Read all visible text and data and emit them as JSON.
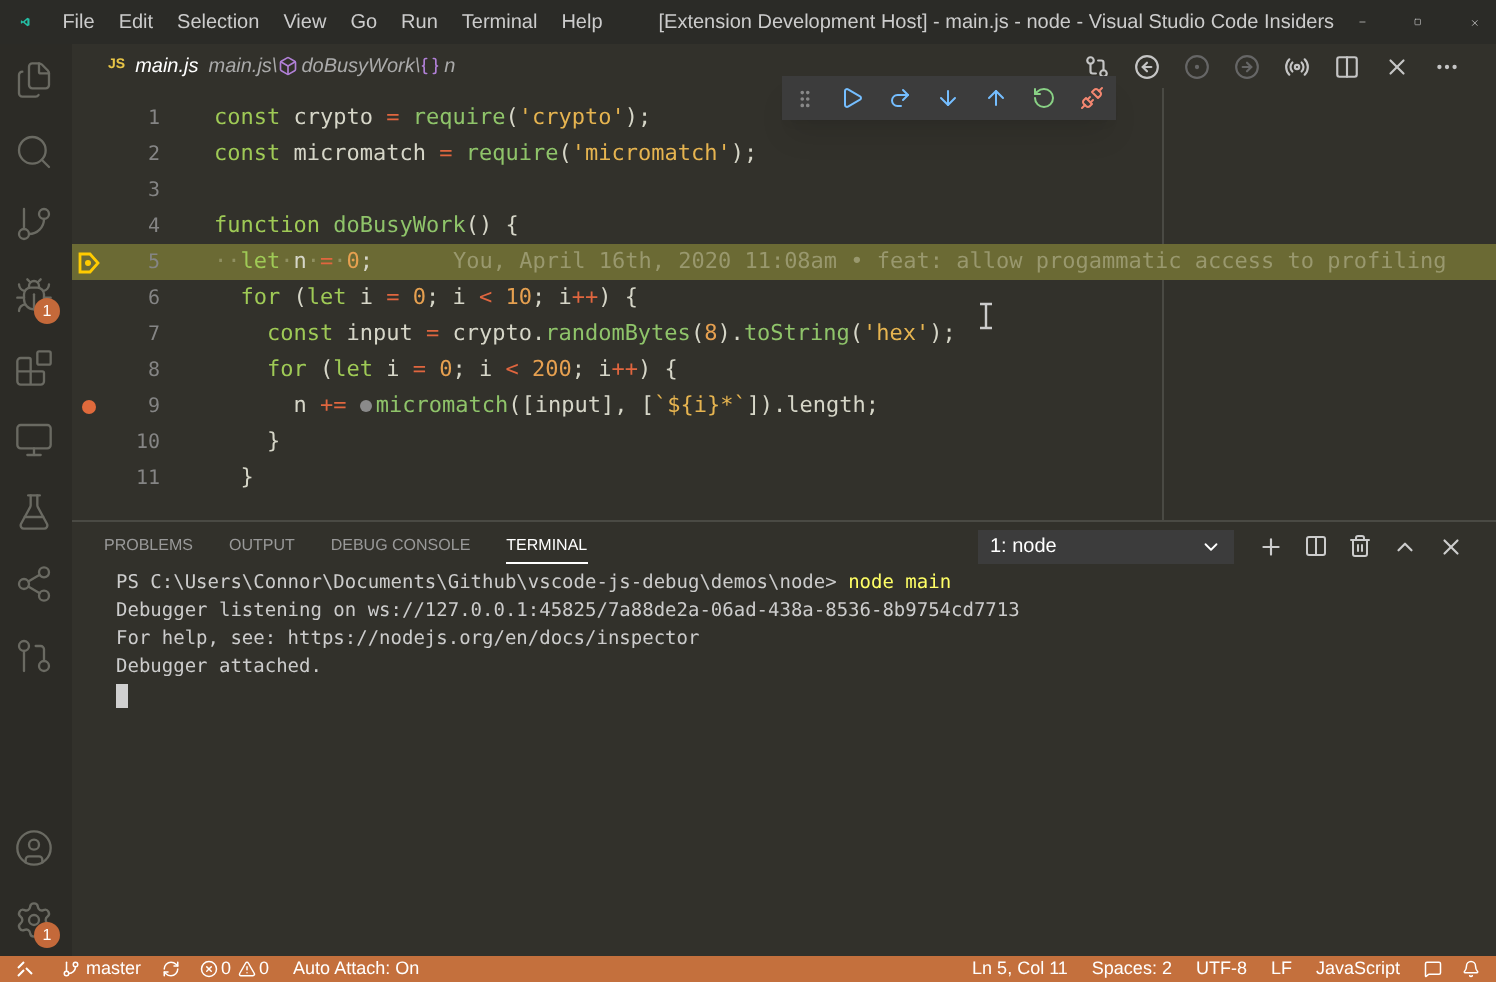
{
  "window": {
    "title": "[Extension Development Host] - main.js - node - Visual Studio Code Insiders"
  },
  "menu": [
    "File",
    "Edit",
    "Selection",
    "View",
    "Go",
    "Run",
    "Terminal",
    "Help"
  ],
  "activity_bar": [
    {
      "kind": "files",
      "selected": false
    },
    {
      "kind": "search",
      "selected": false
    },
    {
      "kind": "git",
      "selected": false
    },
    {
      "kind": "debug",
      "selected": false,
      "badge": "1"
    },
    {
      "kind": "extensions",
      "selected": false
    },
    {
      "kind": "remote",
      "selected": false
    },
    {
      "kind": "test",
      "selected": false
    },
    {
      "kind": "share",
      "selected": false
    },
    {
      "kind": "pr",
      "selected": false
    }
  ],
  "activity_bottom": [
    {
      "kind": "account"
    },
    {
      "kind": "settings",
      "badge": "1"
    }
  ],
  "editor": {
    "tab": {
      "icon": "JS",
      "label": "main.js"
    },
    "breadcrumbs": [
      {
        "kind": "file",
        "label": "main.js\\"
      },
      {
        "kind": "function",
        "label": "doBusyWork\\"
      },
      {
        "kind": "variable",
        "label": "n"
      }
    ],
    "lines": [
      {
        "number": "1",
        "current": false,
        "breakpoint": false,
        "tokens": [
          {
            "kind": "kw",
            "text": "const"
          },
          {
            "kind": "id",
            "text": " crypto "
          },
          {
            "kind": "op",
            "text": "="
          },
          {
            "kind": "fn",
            "text": " require"
          },
          {
            "kind": "id",
            "text": "("
          },
          {
            "kind": "str",
            "text": "'crypto'"
          },
          {
            "kind": "id",
            "text": ");"
          }
        ]
      },
      {
        "number": "2",
        "current": false,
        "breakpoint": false,
        "tokens": [
          {
            "kind": "kw",
            "text": "const"
          },
          {
            "kind": "id",
            "text": " micromatch "
          },
          {
            "kind": "op",
            "text": "="
          },
          {
            "kind": "fn",
            "text": " require"
          },
          {
            "kind": "id",
            "text": "("
          },
          {
            "kind": "str",
            "text": "'micromatch'"
          },
          {
            "kind": "id",
            "text": ");"
          }
        ]
      },
      {
        "number": "3",
        "current": false,
        "breakpoint": false
      },
      {
        "number": "4",
        "current": false,
        "breakpoint": false,
        "tokens": [
          {
            "kind": "kw",
            "text": "function"
          },
          {
            "kind": "fn",
            "text": " doBusyWork"
          },
          {
            "kind": "id",
            "text": "() {"
          }
        ]
      },
      {
        "number": "5",
        "current": true,
        "breakpoint": false,
        "tokens": [
          {
            "kind": "ws",
            "text": "··"
          },
          {
            "kind": "kw",
            "text": "let"
          },
          {
            "kind": "ws",
            "text": "·"
          },
          {
            "kind": "id",
            "text": "n"
          },
          {
            "kind": "ws",
            "text": "·"
          },
          {
            "kind": "op",
            "text": "="
          },
          {
            "kind": "ws",
            "text": "·"
          },
          {
            "kind": "num",
            "text": "0"
          },
          {
            "kind": "id",
            "text": ";"
          }
        ],
        "blame": "You, April 16th, 2020 11:08am • feat: allow progammatic access to profiling"
      },
      {
        "number": "6",
        "current": false,
        "breakpoint": false,
        "tokens": [
          {
            "kind": "kw",
            "text": "  for"
          },
          {
            "kind": "id",
            "text": " ("
          },
          {
            "kind": "kw",
            "text": "let"
          },
          {
            "kind": "id",
            "text": " i "
          },
          {
            "kind": "op",
            "text": "="
          },
          {
            "kind": "num",
            "text": " 0"
          },
          {
            "kind": "id",
            "text": "; i "
          },
          {
            "kind": "op",
            "text": "<"
          },
          {
            "kind": "num",
            "text": " 10"
          },
          {
            "kind": "id",
            "text": "; i"
          },
          {
            "kind": "op",
            "text": "++"
          },
          {
            "kind": "id",
            "text": ") {"
          }
        ]
      },
      {
        "number": "7",
        "current": false,
        "breakpoint": false,
        "tokens": [
          {
            "kind": "kw",
            "text": "    const"
          },
          {
            "kind": "id",
            "text": " input "
          },
          {
            "kind": "op",
            "text": "="
          },
          {
            "kind": "id",
            "text": " crypto."
          },
          {
            "kind": "fn",
            "text": "randomBytes"
          },
          {
            "kind": "id",
            "text": "("
          },
          {
            "kind": "num",
            "text": "8"
          },
          {
            "kind": "id",
            "text": ")."
          },
          {
            "kind": "fn",
            "text": "toString"
          },
          {
            "kind": "id",
            "text": "("
          },
          {
            "kind": "str",
            "text": "'hex'"
          },
          {
            "kind": "id",
            "text": ");"
          }
        ]
      },
      {
        "number": "8",
        "current": false,
        "breakpoint": false,
        "tokens": [
          {
            "kind": "kw",
            "text": "    for"
          },
          {
            "kind": "id",
            "text": " ("
          },
          {
            "kind": "kw",
            "text": "let"
          },
          {
            "kind": "id",
            "text": " i "
          },
          {
            "kind": "op",
            "text": "="
          },
          {
            "kind": "num",
            "text": " 0"
          },
          {
            "kind": "id",
            "text": "; i "
          },
          {
            "kind": "op",
            "text": "<"
          },
          {
            "kind": "num",
            "text": " 200"
          },
          {
            "kind": "id",
            "text": "; i"
          },
          {
            "kind": "op",
            "text": "++"
          },
          {
            "kind": "id",
            "text": ") {"
          }
        ]
      },
      {
        "number": "9",
        "current": false,
        "breakpoint": true,
        "tokens": [
          {
            "kind": "id",
            "text": "      n "
          },
          {
            "kind": "op",
            "text": "+= "
          },
          {
            "kind": "inline-bp"
          },
          {
            "kind": "fn",
            "text": "micromatch"
          },
          {
            "kind": "id",
            "text": "([input], ["
          },
          {
            "kind": "str",
            "text": "`${i}*`"
          },
          {
            "kind": "id",
            "text": "]).length;"
          }
        ]
      },
      {
        "number": "10",
        "current": false,
        "breakpoint": false,
        "tokens": [
          {
            "kind": "id",
            "text": "    }"
          }
        ]
      },
      {
        "number": "11",
        "current": false,
        "breakpoint": false,
        "tokens": [
          {
            "kind": "id",
            "text": "  }"
          }
        ]
      }
    ]
  },
  "debug_toolbar": [
    {
      "kind": "continue"
    },
    {
      "kind": "step-over"
    },
    {
      "kind": "step-into"
    },
    {
      "kind": "step-out"
    },
    {
      "kind": "restart"
    },
    {
      "kind": "disconnect"
    }
  ],
  "panel": {
    "tabs": [
      {
        "label": "PROBLEMS",
        "selected": false
      },
      {
        "label": "OUTPUT",
        "selected": false
      },
      {
        "label": "DEBUG CONSOLE",
        "selected": false
      },
      {
        "label": "TERMINAL",
        "selected": true
      }
    ],
    "terminal_select": "1: node",
    "terminal": {
      "prompt": "PS C:\\Users\\Connor\\Documents\\Github\\vscode-js-debug\\demos\\node>",
      "command": "node main",
      "output": [
        "Debugger listening on ws://127.0.0.1:45825/7a88de2a-06ad-438a-8536-8b9754cd7713",
        "For help, see: https://nodejs.org/en/docs/inspector",
        "Debugger attached."
      ]
    }
  },
  "status_bar": {
    "branch": "master",
    "errors": "0",
    "warnings": "0",
    "auto_attach": "Auto Attach: On",
    "right": [
      "Ln 5, Col 11",
      "Spaces: 2",
      "UTF-8",
      "LF",
      "JavaScript"
    ]
  }
}
